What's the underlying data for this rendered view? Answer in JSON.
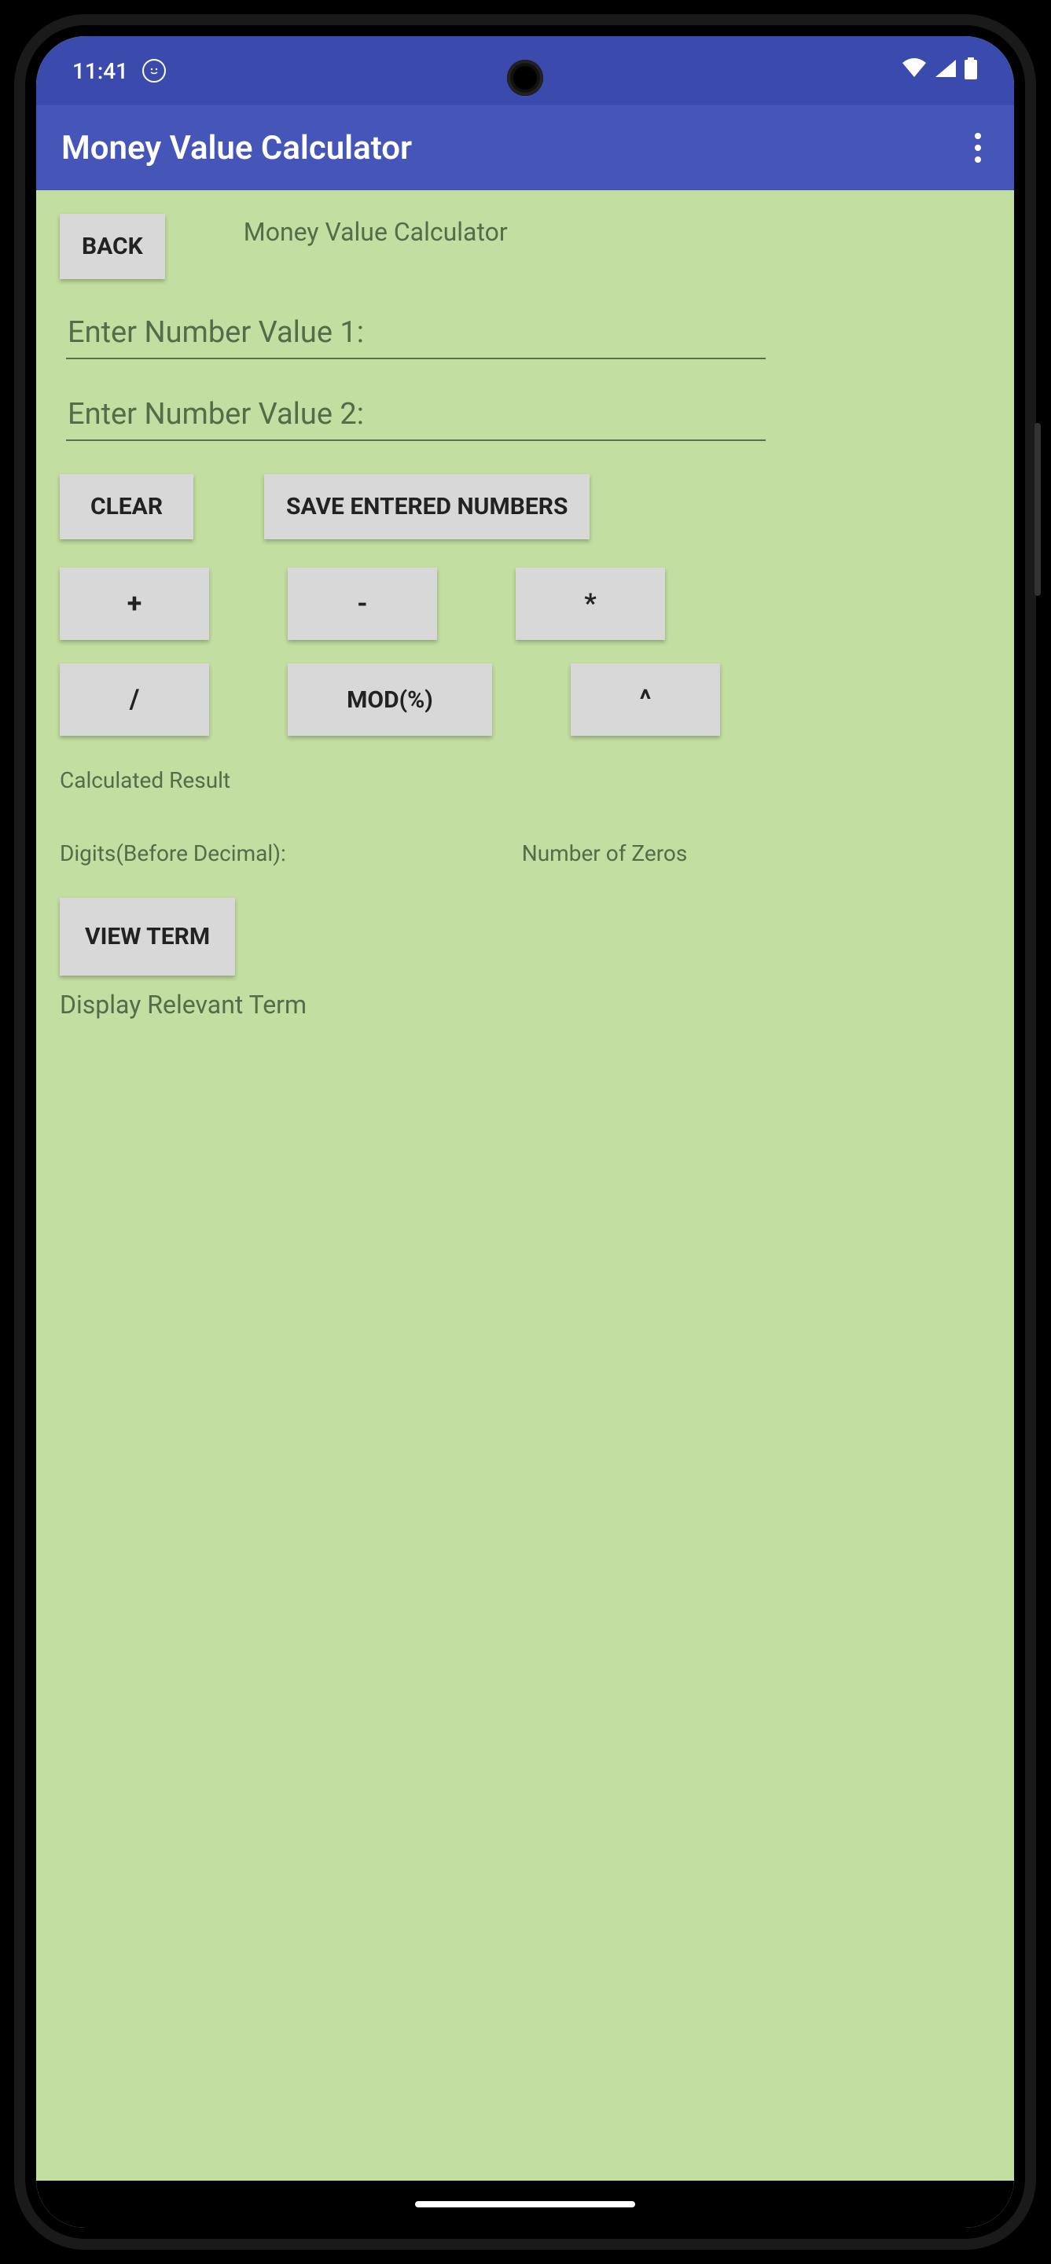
{
  "status": {
    "time": "11:41"
  },
  "app": {
    "title": "Money Value Calculator"
  },
  "content": {
    "back_label": "BACK",
    "subtitle": "Money Value Calculator",
    "input1_placeholder": "Enter Number Value 1:",
    "input2_placeholder": "Enter Number Value 2:",
    "clear_label": "CLEAR",
    "save_label": "SAVE ENTERED NUMBERS",
    "ops": {
      "plus": "+",
      "minus": "-",
      "multiply": "*",
      "divide": "/",
      "mod": "MOD(%)",
      "power": "^"
    },
    "result_label": "Calculated Result",
    "digits_label": "Digits(Before Decimal):",
    "zeros_label": "Number of Zeros",
    "view_term_label": "VIEW TERM",
    "display_term_text": "Display Relevant Term"
  }
}
